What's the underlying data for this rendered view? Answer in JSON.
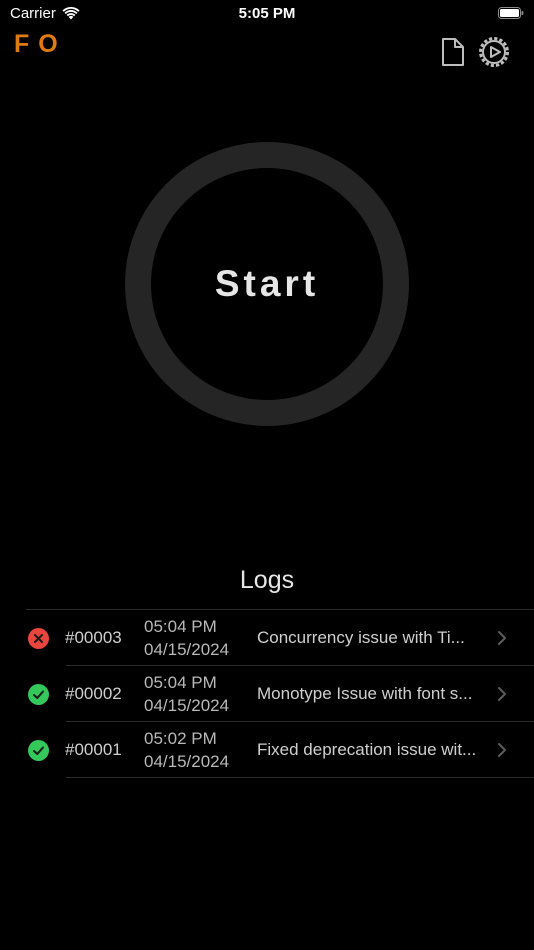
{
  "status_bar": {
    "carrier": "Carrier",
    "time": "5:05 PM"
  },
  "header": {
    "brand": "FO",
    "brand_color": "#e07b12",
    "icons": [
      "document-icon",
      "gear-icon"
    ]
  },
  "main": {
    "start_label": "Start"
  },
  "logs": {
    "title": "Logs",
    "items": [
      {
        "status": "failed",
        "status_color": "#e8453c",
        "id": "#00003",
        "time": "05:04 PM",
        "date": "04/15/2024",
        "message": "Concurrency issue with Ti..."
      },
      {
        "status": "success",
        "status_color": "#34c759",
        "id": "#00002",
        "time": "05:04 PM",
        "date": "04/15/2024",
        "message": "Monotype Issue with font s..."
      },
      {
        "status": "success",
        "status_color": "#34c759",
        "id": "#00001",
        "time": "05:02 PM",
        "date": "04/15/2024",
        "message": "Fixed deprecation issue wit..."
      }
    ]
  }
}
